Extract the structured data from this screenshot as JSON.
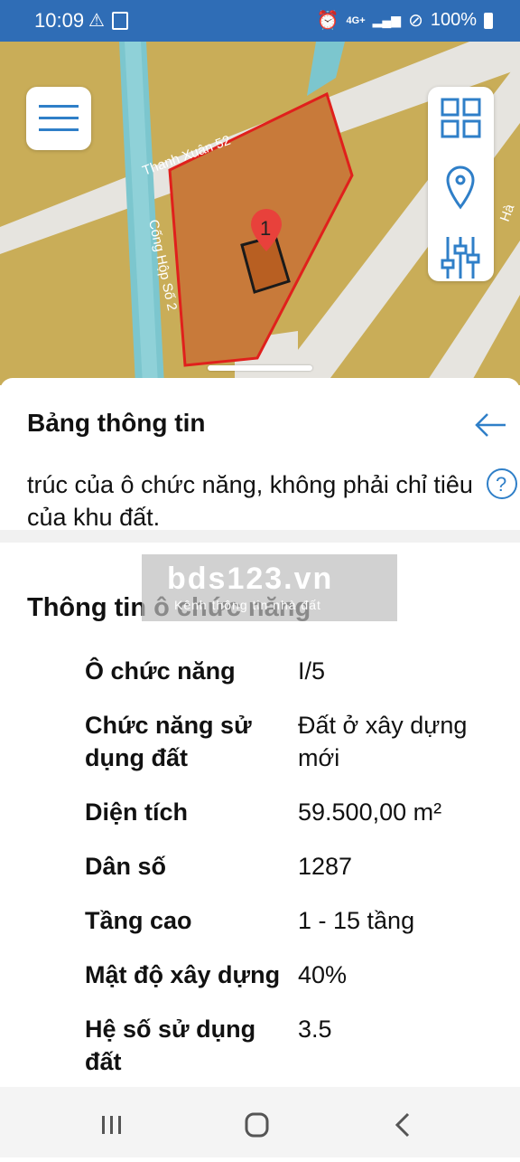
{
  "status_bar": {
    "time": "10:09",
    "network": "4G+",
    "battery": "100%"
  },
  "map": {
    "street_label": "Thanh Xuân 52",
    "canal_label": "Cống Hộp Số 2",
    "edge_label": "Hà",
    "marker_label": "1",
    "colors": {
      "land": "#c9ad58",
      "parcel_fill": "#c87a3a",
      "parcel_border": "#e0201c",
      "canal": "#7cc6ce",
      "road": "#e6e4df",
      "marker": "#e8413b"
    }
  },
  "sheet": {
    "title": "Bảng thông tin",
    "partial_text": "trúc của ô chức năng, không phải chỉ tiêu của khu đất.",
    "watermark_main": "bds123.vn",
    "watermark_sub": "Kênh thông tin nhà đất",
    "section_title": "Thông tin ô chức năng",
    "rows": [
      {
        "key": "Ô chức năng",
        "value": "I/5"
      },
      {
        "key": "Chức năng sử dụng đất",
        "value": "Đất ở xây dựng mới"
      },
      {
        "key": "Diện tích",
        "value": "59.500,00 m²"
      },
      {
        "key": "Dân số",
        "value": "1287"
      },
      {
        "key": "Tầng cao",
        "value": "1 - 15 tầng"
      },
      {
        "key": "Mật độ xây dựng",
        "value": "40%"
      },
      {
        "key": "Hệ số sử dụng đất",
        "value": "3.5"
      }
    ]
  },
  "icons": {
    "menu": "hamburger-icon",
    "grid": "grid-icon",
    "location": "location-pin-icon",
    "filter": "sliders-icon",
    "back": "arrow-left-icon",
    "help": "help-icon",
    "accent": "#2f7fc8"
  }
}
